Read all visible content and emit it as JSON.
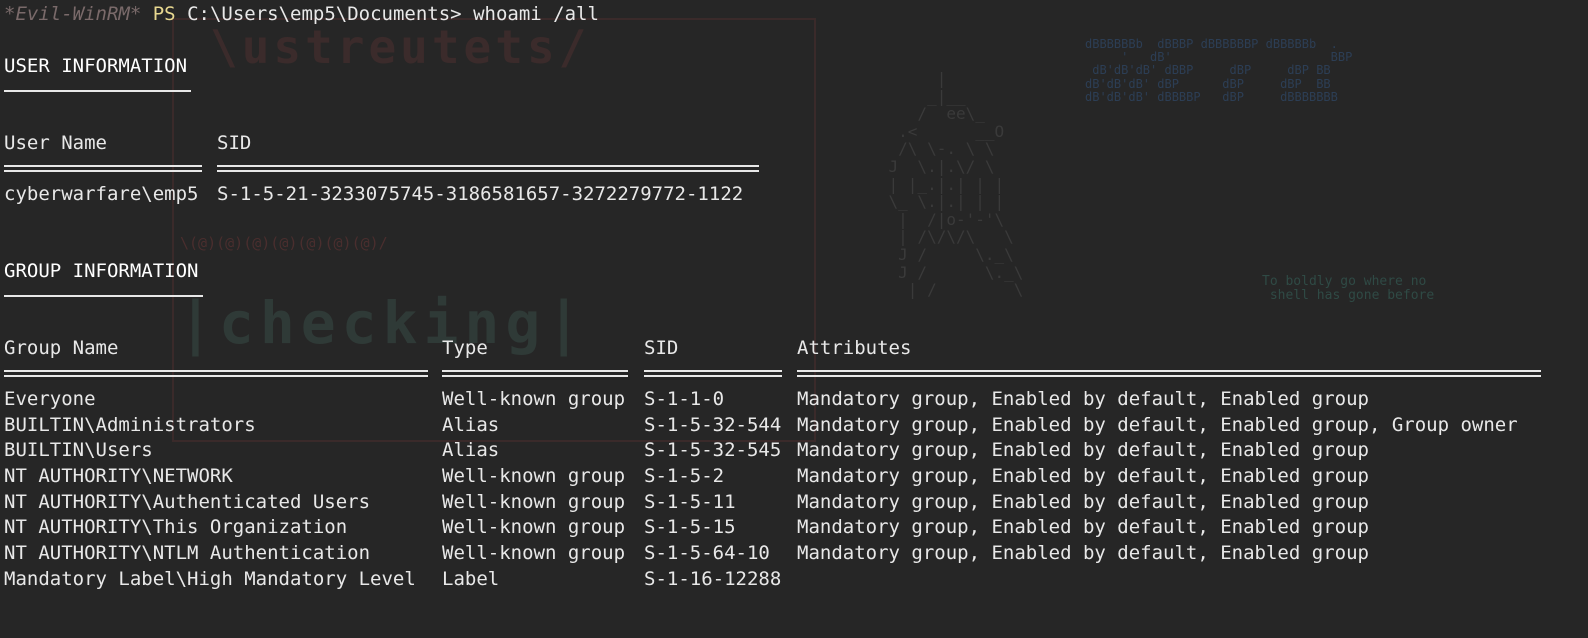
{
  "terminal": {
    "prompt_name": "*Evil-WinRM*",
    "prompt_ps": "PS",
    "prompt_path": "C:\\Users\\emp5\\Documents>",
    "command": "whoami /all"
  },
  "user_info": {
    "title": "USER INFORMATION",
    "headers": [
      "User Name",
      "SID"
    ],
    "rows": [
      [
        "cyberwarfare\\emp5",
        "S-1-5-21-3233075745-3186581657-3272279772-1122"
      ]
    ]
  },
  "group_info": {
    "title": "GROUP INFORMATION",
    "headers": [
      "Group Name",
      "Type",
      "SID",
      "Attributes"
    ],
    "rows": [
      [
        "Everyone",
        "Well-known group",
        "S-1-1-0",
        "Mandatory group, Enabled by default, Enabled group"
      ],
      [
        "BUILTIN\\Administrators",
        "Alias",
        "S-1-5-32-544",
        "Mandatory group, Enabled by default, Enabled group, Group owner"
      ],
      [
        "BUILTIN\\Users",
        "Alias",
        "S-1-5-32-545",
        "Mandatory group, Enabled by default, Enabled group"
      ],
      [
        "NT AUTHORITY\\NETWORK",
        "Well-known group",
        "S-1-5-2",
        "Mandatory group, Enabled by default, Enabled group"
      ],
      [
        "NT AUTHORITY\\Authenticated Users",
        "Well-known group",
        "S-1-5-11",
        "Mandatory group, Enabled by default, Enabled group"
      ],
      [
        "NT AUTHORITY\\This Organization",
        "Well-known group",
        "S-1-5-15",
        "Mandatory group, Enabled by default, Enabled group"
      ],
      [
        "NT AUTHORITY\\NTLM Authentication",
        "Well-known group",
        "S-1-5-64-10",
        "Mandatory group, Enabled by default, Enabled group"
      ],
      [
        "Mandatory Label\\High Mandatory Level",
        "Label",
        "S-1-16-12288",
        ""
      ]
    ]
  },
  "wallpaper": {
    "quote": "To boldly go where no\n shell has gone before",
    "colors": {
      "background": "#262626",
      "text": "#e8e8e8",
      "prompt_name": "#7a6a6a",
      "prompt_ps": "#e8d890"
    }
  }
}
